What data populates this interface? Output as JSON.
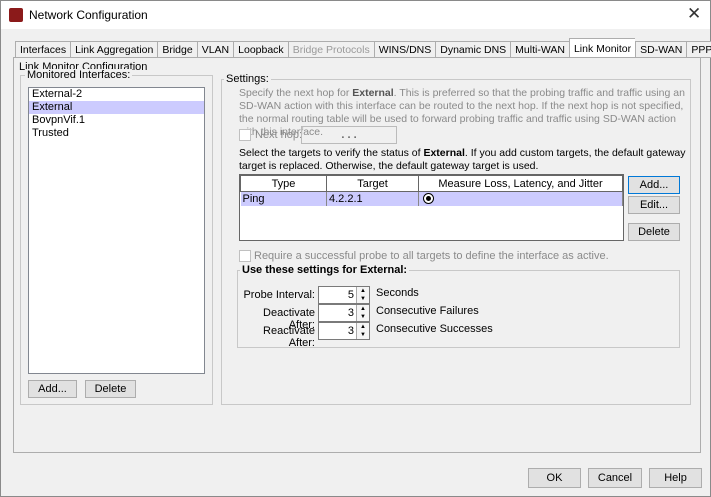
{
  "window": {
    "title": "Network Configuration"
  },
  "tabs": [
    {
      "label": "Interfaces"
    },
    {
      "label": "Link Aggregation"
    },
    {
      "label": "Bridge"
    },
    {
      "label": "VLAN"
    },
    {
      "label": "Loopback"
    },
    {
      "label": "Bridge Protocols",
      "disabled": true
    },
    {
      "label": "WINS/DNS"
    },
    {
      "label": "Dynamic DNS"
    },
    {
      "label": "Multi-WAN"
    },
    {
      "label": "Link Monitor",
      "selected": true
    },
    {
      "label": "SD-WAN"
    },
    {
      "label": "PPPoE"
    }
  ],
  "panel_title": "Link Monitor Configuration",
  "monitored": {
    "legend": "Monitored Interfaces:",
    "items": [
      "External-2",
      "External",
      "BovpnVif.1",
      "Trusted"
    ],
    "selected": "External",
    "add_label": "Add...",
    "delete_label": "Delete"
  },
  "settings": {
    "legend": "Settings:",
    "nexthop_desc_pre": "Specify the next hop for ",
    "iface": "External",
    "nexthop_desc_post": ". This is preferred so that the probing traffic and traffic using an SD-WAN action with this interface can be routed to the next hop. If the next hop is not specified, the normal routing table will be used to forward probing traffic and traffic using SD-WAN action with this interface.",
    "nexthop_label": "Next hop:",
    "nexthop_value": ".   .   .",
    "targets_desc_pre": "Select the targets to verify the status of ",
    "targets_desc_post": ". If you add custom targets, the default gateway target is replaced. Otherwise, the default gateway target is used.",
    "columns": [
      "Type",
      "Target",
      "Measure Loss, Latency, and Jitter"
    ],
    "rows": [
      {
        "type": "Ping",
        "target": "4.2.2.1",
        "measure": true
      }
    ],
    "add_label": "Add...",
    "edit_label": "Edit...",
    "delete_label": "Delete",
    "require_label": "Require a successful probe to all targets to define the interface as active.",
    "use_legend": "Use these settings for External:",
    "probe_label": "Probe Interval:",
    "probe_value": "5",
    "probe_unit": "Seconds",
    "deact_label": "Deactivate After:",
    "deact_value": "3",
    "deact_unit": "Consecutive Failures",
    "react_label": "Reactivate After:",
    "react_value": "3",
    "react_unit": "Consecutive Successes"
  },
  "footer": {
    "ok": "OK",
    "cancel": "Cancel",
    "help": "Help"
  }
}
